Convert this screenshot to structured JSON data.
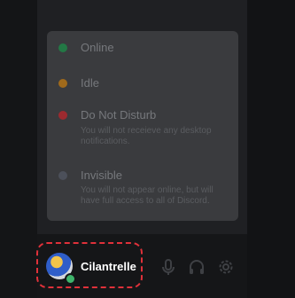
{
  "status_menu": {
    "items": [
      {
        "label": "Online",
        "color": "#237845",
        "description": ""
      },
      {
        "label": "Idle",
        "color": "#a06a1b",
        "description": ""
      },
      {
        "label": "Do Not Disturb",
        "color": "#9c2a2f",
        "description": "You will not receieve any desktop notifications."
      },
      {
        "label": "Invisible",
        "color": "#4c505a",
        "description": "You will not appear online, but will have full access to all of Discord."
      }
    ]
  },
  "user_panel": {
    "username": "Cilantrelle",
    "status_color": "#3fb46b",
    "icons": [
      "microphone-icon",
      "headphones-icon",
      "settings-gear-icon"
    ]
  }
}
